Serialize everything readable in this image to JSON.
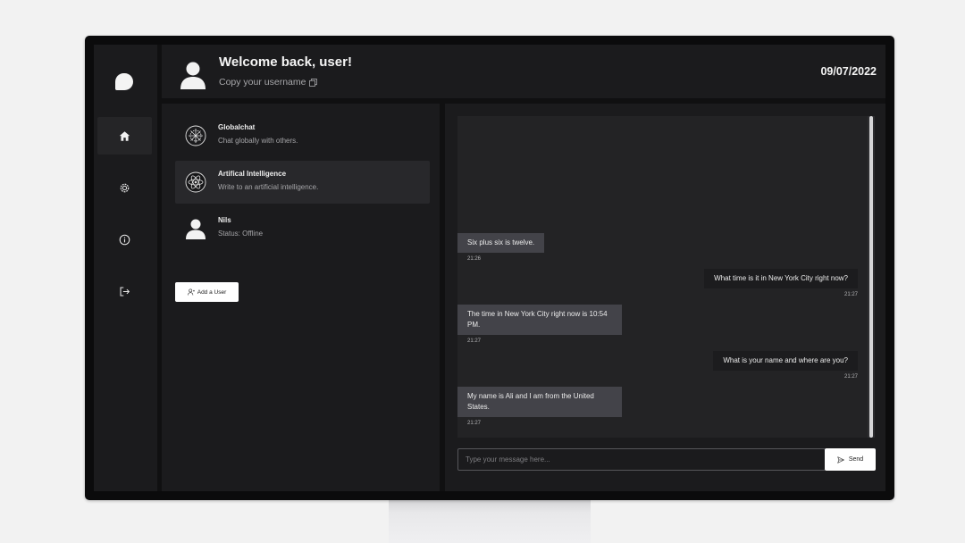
{
  "header": {
    "welcome": "Welcome back, user!",
    "copy_username": "Copy your username",
    "date": "09/07/2022"
  },
  "sidebar": {
    "items": [
      {
        "icon": "home-icon",
        "active": true
      },
      {
        "icon": "gear-icon",
        "active": false
      },
      {
        "icon": "info-icon",
        "active": false
      },
      {
        "icon": "logout-icon",
        "active": false
      }
    ]
  },
  "chats": [
    {
      "name": "Globalchat",
      "subtitle": "Chat globally with others.",
      "icon": "globe-icon",
      "active": false
    },
    {
      "name": "Artifical Intelligence",
      "subtitle": "Write to an artificial intelligence.",
      "icon": "ai-icon",
      "active": true
    },
    {
      "name": "Nils",
      "subtitle": "Status: Offline",
      "icon": "user-avatar-icon",
      "active": false
    }
  ],
  "add_user_label": "Add a User",
  "messages": [
    {
      "from": "bot",
      "text": "Six plus six is twelve.",
      "time": "21:26"
    },
    {
      "from": "user",
      "text": "What time is it in New York City right now?",
      "time": "21:27"
    },
    {
      "from": "bot",
      "text": "The time in New York City right now is 10:54 PM.",
      "time": "21:27"
    },
    {
      "from": "user",
      "text": "What is your name and where are you?",
      "time": "21:27"
    },
    {
      "from": "bot",
      "text": "My name is Ali and I am from the United States.",
      "time": "21:27"
    }
  ],
  "composer": {
    "placeholder": "Type your message here...",
    "value": "",
    "send_label": "Send"
  },
  "colors": {
    "background": "#101011",
    "panel": "#1b1b1d",
    "bot_bubble": "#434349",
    "user_bubble": "#1c1c1e",
    "accent": "#ffffff"
  }
}
